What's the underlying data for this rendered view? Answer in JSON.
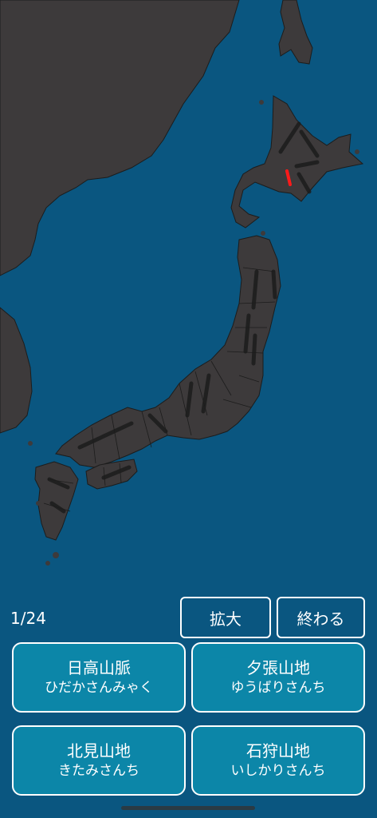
{
  "quiz": {
    "progress": "1/24"
  },
  "buttons": {
    "zoom_label": "拡大",
    "end_label": "終わる"
  },
  "answers": [
    {
      "kanji": "日高山脈",
      "kana": "ひだかさんみゃく"
    },
    {
      "kanji": "夕張山地",
      "kana": "ゆうばりさんち"
    },
    {
      "kanji": "北見山地",
      "kana": "きたみさんち"
    },
    {
      "kanji": "石狩山地",
      "kana": "いしかりさんち"
    }
  ],
  "colors": {
    "sea": "#0a5680",
    "land": "#3d3a3b",
    "border": "#1c1c1c",
    "highlight": "#ff1a1a",
    "answer_bg": "#0c86a8"
  }
}
